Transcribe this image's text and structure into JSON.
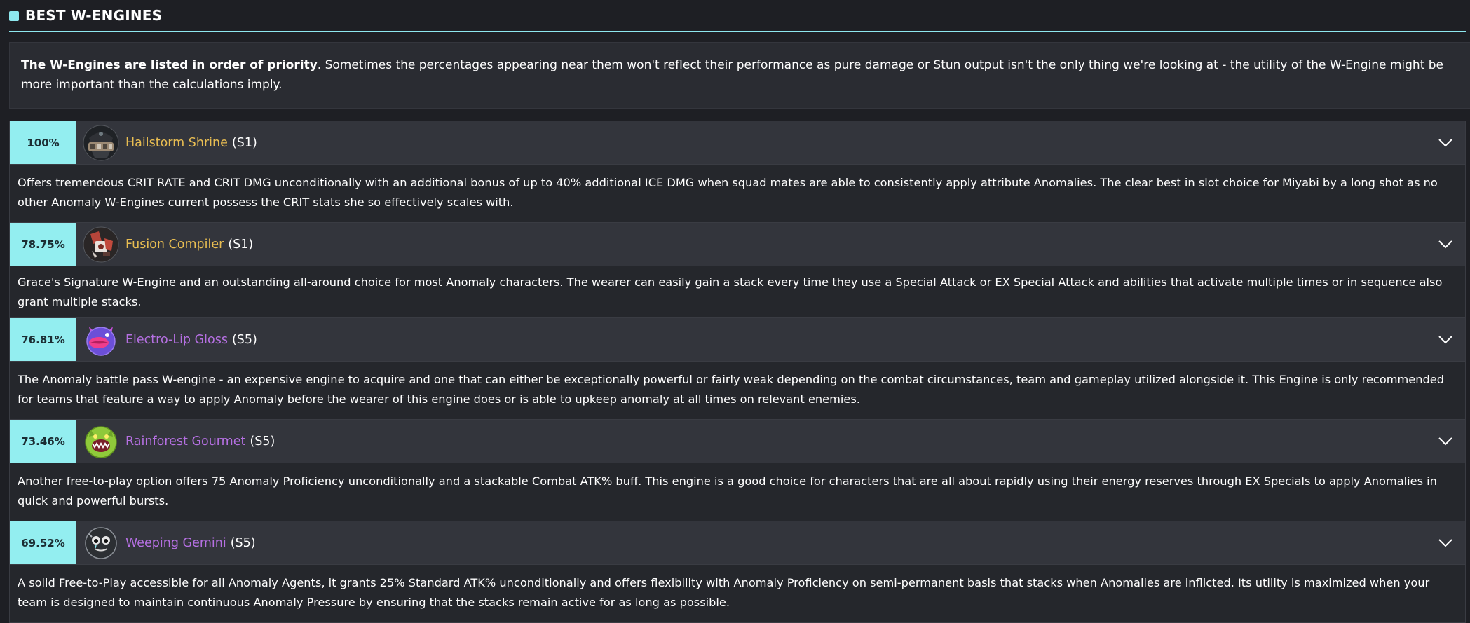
{
  "section": {
    "title": "BEST W-ENGINES"
  },
  "intro": {
    "bold": "The W-Engines are listed in order of priority",
    "rest": ". Sometimes the percentages appearing near them won't reflect their performance as pure damage or Stun output isn't the only thing we're looking at - the utility of the W-Engine might be more important than the calculations imply."
  },
  "engines": [
    {
      "percent": "100%",
      "name": "Hailstorm Shrine",
      "rank": "(S1)",
      "rarity": "S",
      "rarity_color": "#e8bd52",
      "icon": "hailstorm-shrine-icon",
      "description": "Offers tremendous CRIT RATE and CRIT DMG unconditionally with an additional bonus of up to 40% additional ICE DMG when squad mates are able to consistently apply attribute Anomalies. The clear best in slot choice for Miyabi by a long shot as no other Anomaly W-Engines current possess the CRIT stats she so effectively scales with."
    },
    {
      "percent": "78.75%",
      "name": "Fusion Compiler",
      "rank": "(S1)",
      "rarity": "S",
      "rarity_color": "#e8bd52",
      "icon": "fusion-compiler-icon",
      "description": "Grace's Signature W-Engine and an outstanding all-around choice for most Anomaly characters. The wearer can easily gain a stack every time they use a Special Attack or EX Special Attack and abilities that activate multiple times or in sequence also grant multiple stacks."
    },
    {
      "percent": "76.81%",
      "name": "Electro-Lip Gloss",
      "rank": "(S5)",
      "rarity": "A",
      "rarity_color": "#b670e3",
      "icon": "electro-lip-gloss-icon",
      "description": "The Anomaly battle pass W-engine - an expensive engine to acquire and one that can either be exceptionally powerful or fairly weak depending on the combat circumstances, team and gameplay utilized alongside it. This Engine is only recommended for teams that feature a way to apply Anomaly before the wearer of this engine does or is able to upkeep anomaly at all times on relevant enemies."
    },
    {
      "percent": "73.46%",
      "name": "Rainforest Gourmet",
      "rank": "(S5)",
      "rarity": "A",
      "rarity_color": "#b670e3",
      "icon": "rainforest-gourmet-icon",
      "description": "Another free-to-play option offers 75 Anomaly Proficiency unconditionally and a stackable Combat ATK% buff. This engine is a good choice for characters that are all about rapidly using their energy reserves through EX Specials to apply Anomalies in quick and powerful bursts."
    },
    {
      "percent": "69.52%",
      "name": "Weeping Gemini",
      "rank": "(S5)",
      "rarity": "A",
      "rarity_color": "#b670e3",
      "icon": "weeping-gemini-icon",
      "description": "A solid Free-to-Play accessible for all Anomaly Agents, it grants 25% Standard ATK% unconditionally and offers flexibility with Anomaly Proficiency on semi-permanent basis that stacks when Anomalies are inflicted. Its utility is maximized when your team is designed to maintain continuous Anomaly Pressure by ensuring that the stacks remain active for as long as possible."
    }
  ],
  "colors": {
    "accent": "#8ee8ef",
    "percent_bg": "#93eef0",
    "background": "#1e1f24",
    "row_header_bg": "#33353c",
    "description_bg": "#25272c"
  }
}
